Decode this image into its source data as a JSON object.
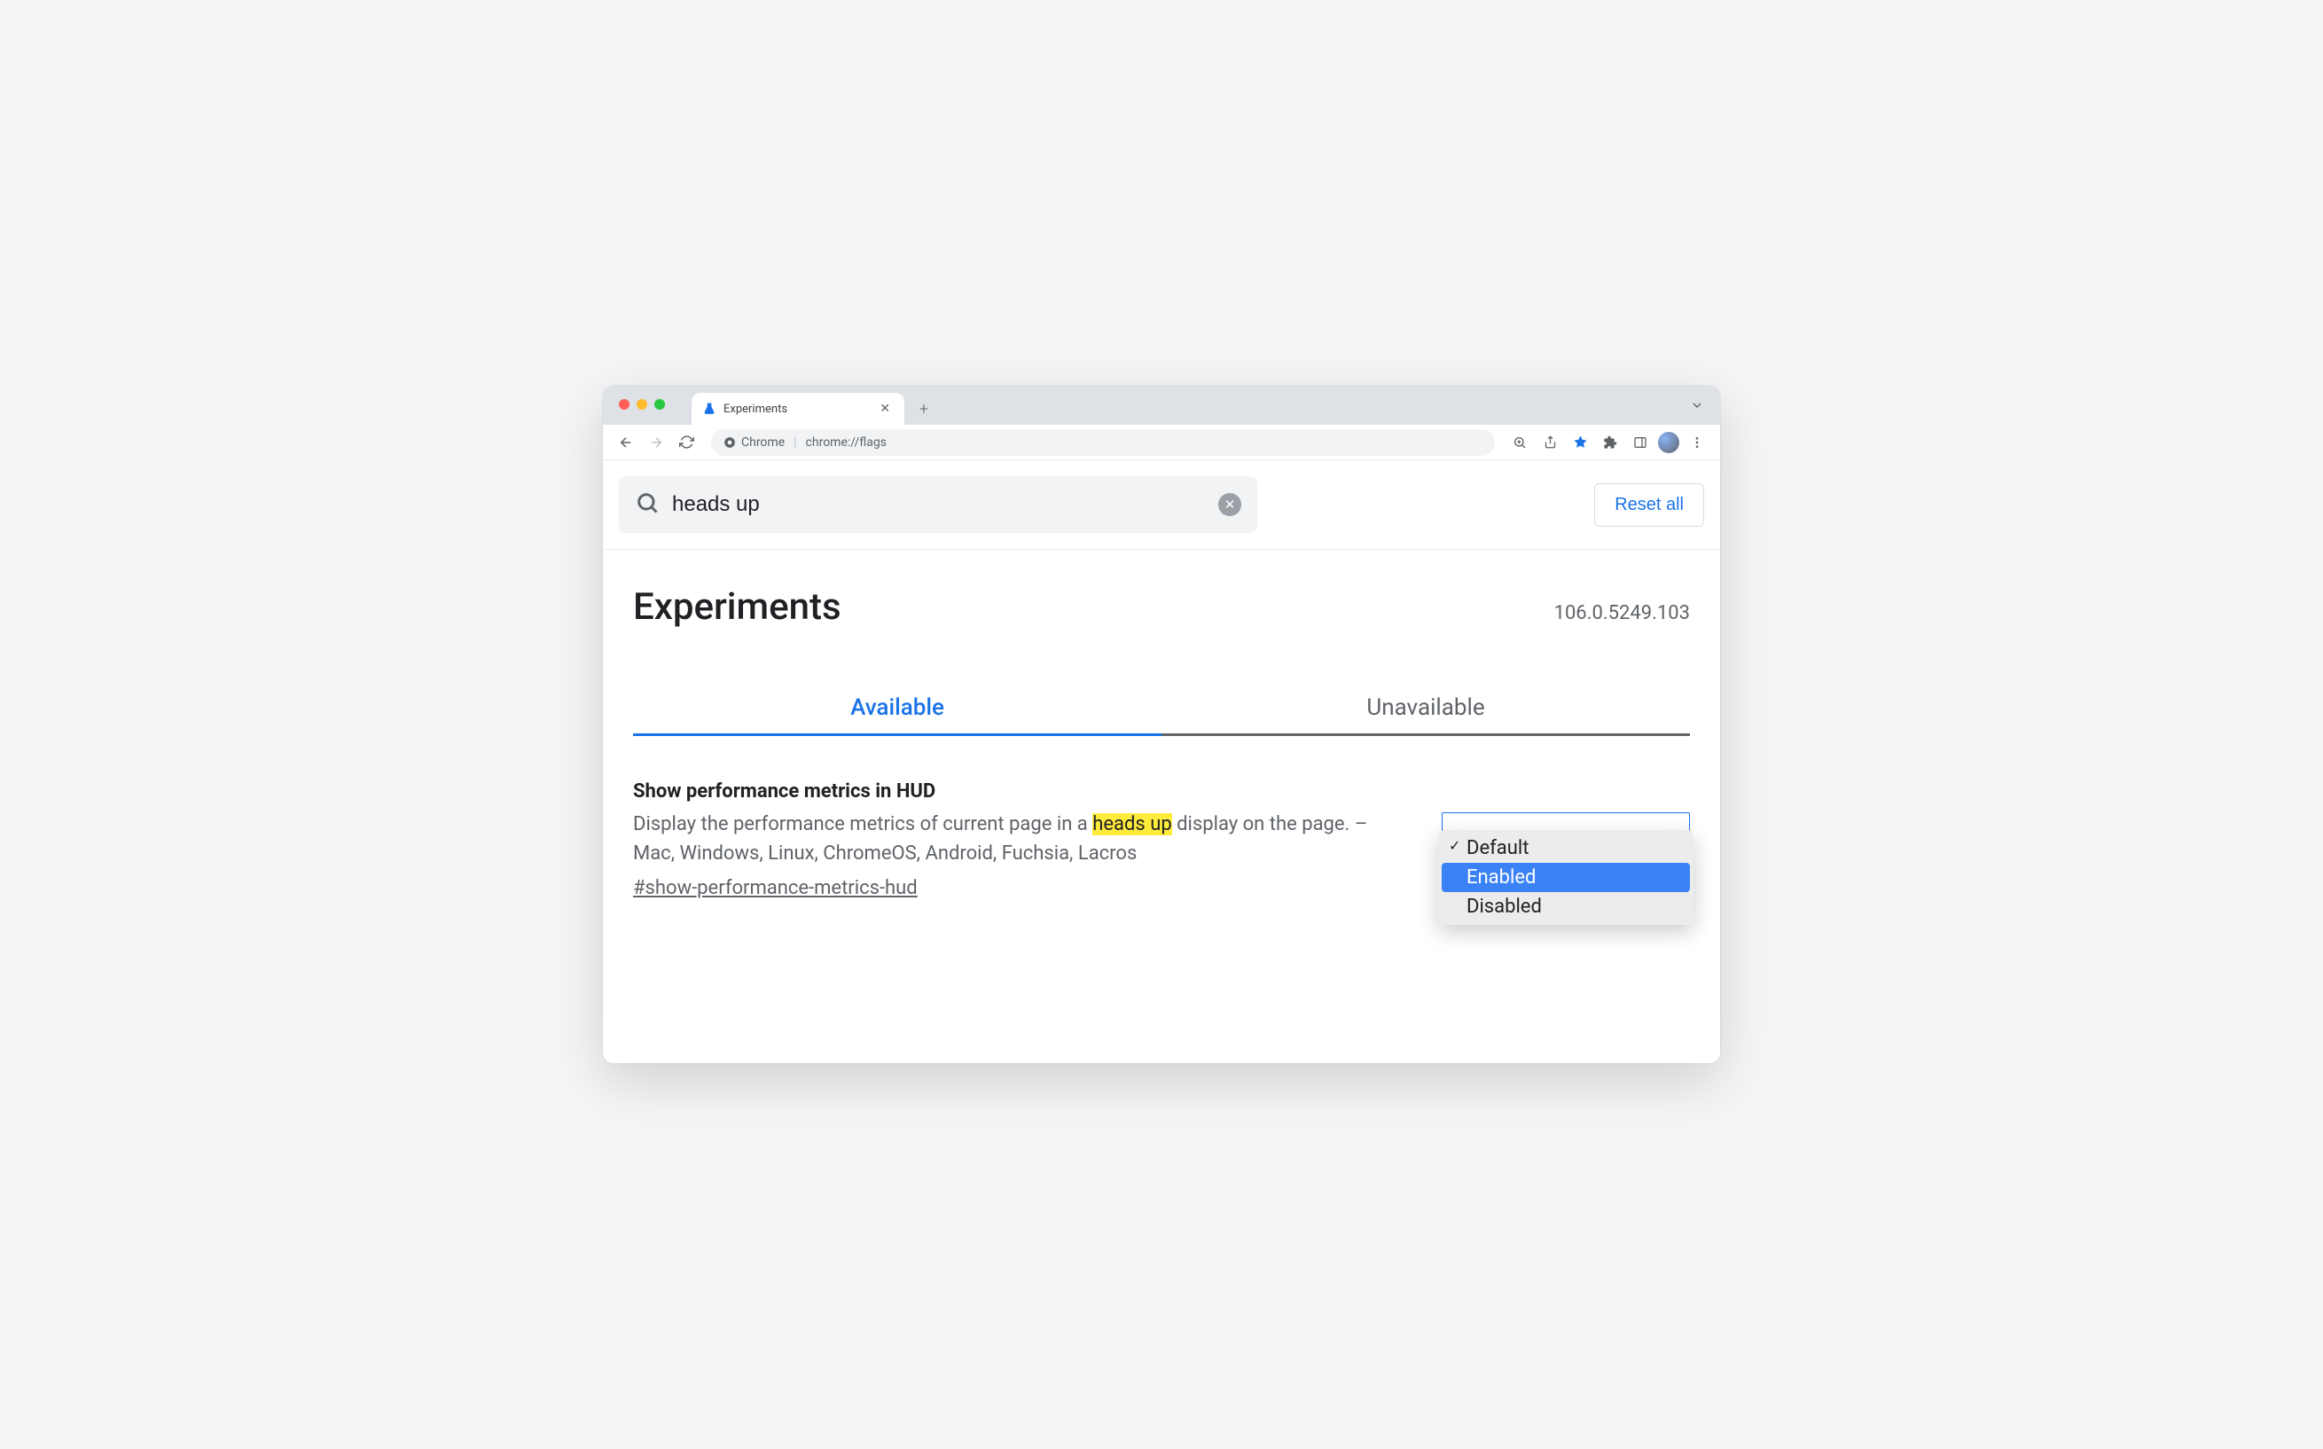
{
  "chrome": {
    "tab_title": "Experiments",
    "omnibox_chip": "Chrome",
    "omnibox_url": "chrome://flags"
  },
  "search": {
    "value": "heads up",
    "reset_label": "Reset all"
  },
  "page": {
    "heading": "Experiments",
    "version": "106.0.5249.103",
    "tabs": {
      "available": "Available",
      "unavailable": "Unavailable"
    }
  },
  "flag": {
    "title": "Show performance metrics in HUD",
    "desc_pre": "Display the performance metrics of current page in a ",
    "desc_hl": "heads up",
    "desc_post": " display on the page. – Mac, Windows, Linux, ChromeOS, Android, Fuchsia, Lacros",
    "anchor": "#show-performance-metrics-hud",
    "options": {
      "default": "Default",
      "enabled": "Enabled",
      "disabled": "Disabled"
    }
  }
}
